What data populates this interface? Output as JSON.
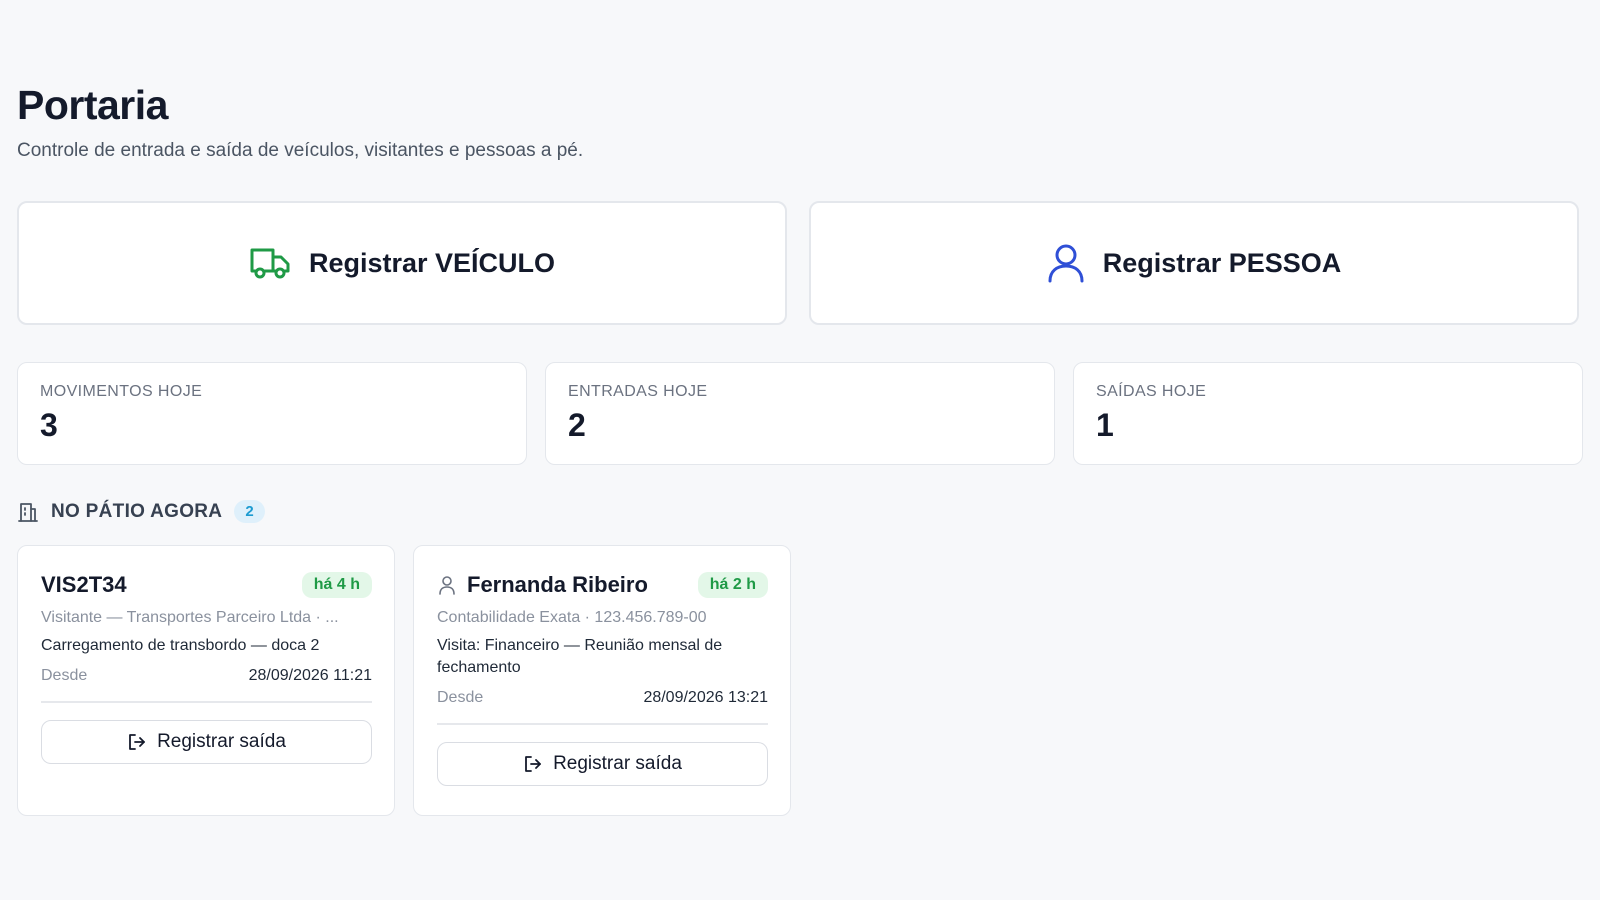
{
  "header": {
    "title": "Portaria",
    "subtitle": "Controle de entrada e saída de veículos, visitantes e pessoas a pé."
  },
  "actions": {
    "vehicle": {
      "label": "Registrar VEÍCULO",
      "icon": "truck-icon",
      "color": "#1f9a46"
    },
    "person": {
      "label": "Registrar PESSOA",
      "icon": "user-icon",
      "color": "#2f4fd6"
    }
  },
  "stats": [
    {
      "label": "MOVIMENTOS HOJE",
      "value": "3"
    },
    {
      "label": "ENTRADAS HOJE",
      "value": "2"
    },
    {
      "label": "SAÍDAS HOJE",
      "value": "1"
    }
  ],
  "yard": {
    "title": "NO PÁTIO AGORA",
    "count": "2",
    "icon": "building-icon",
    "cards": [
      {
        "name": "VIS2T34",
        "time_badge": "há 4 h",
        "meta": "Visitante — Transportes Parceiro Ltda · ...",
        "description": "Carregamento de transbordo — doca 2",
        "since_label": "Desde",
        "since_value": "28/09/2026 11:21",
        "exit_label": "Registrar saída"
      },
      {
        "name": "Fernanda Ribeiro",
        "icon": "user-icon",
        "time_badge": "há 2 h",
        "meta": "Contabilidade Exata · 123.456.789-00",
        "description": "Visita: Financeiro — Reunião mensal de fechamento",
        "since_label": "Desde",
        "since_value": "28/09/2026 13:21",
        "exit_label": "Registrar saída"
      }
    ]
  }
}
